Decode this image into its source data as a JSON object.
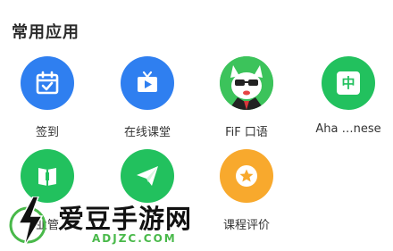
{
  "section": {
    "title": "常用应用"
  },
  "apps": [
    {
      "label": "签到",
      "icon": "calendar-check-icon",
      "color": "#2f7ff0"
    },
    {
      "label": "在线课堂",
      "icon": "tv-play-icon",
      "color": "#2f7ff0"
    },
    {
      "label": "FiF 口语",
      "icon": "cat-mascot-icon",
      "color": "#3cc35b"
    },
    {
      "label": "Aha …nese",
      "icon": "chinese-char-icon",
      "color": "#22c15e",
      "glyph": "中"
    },
    {
      "label": "业管",
      "icon": "book-icon",
      "color": "#22c15e"
    },
    {
      "label": "",
      "icon": "paper-plane-icon",
      "color": "#22c15e"
    },
    {
      "label": "课程评价",
      "icon": "star-badge-icon",
      "color": "#f8a92d"
    }
  ],
  "watermark": {
    "text": "爱豆手游网",
    "url": "ADJZC.COM"
  }
}
